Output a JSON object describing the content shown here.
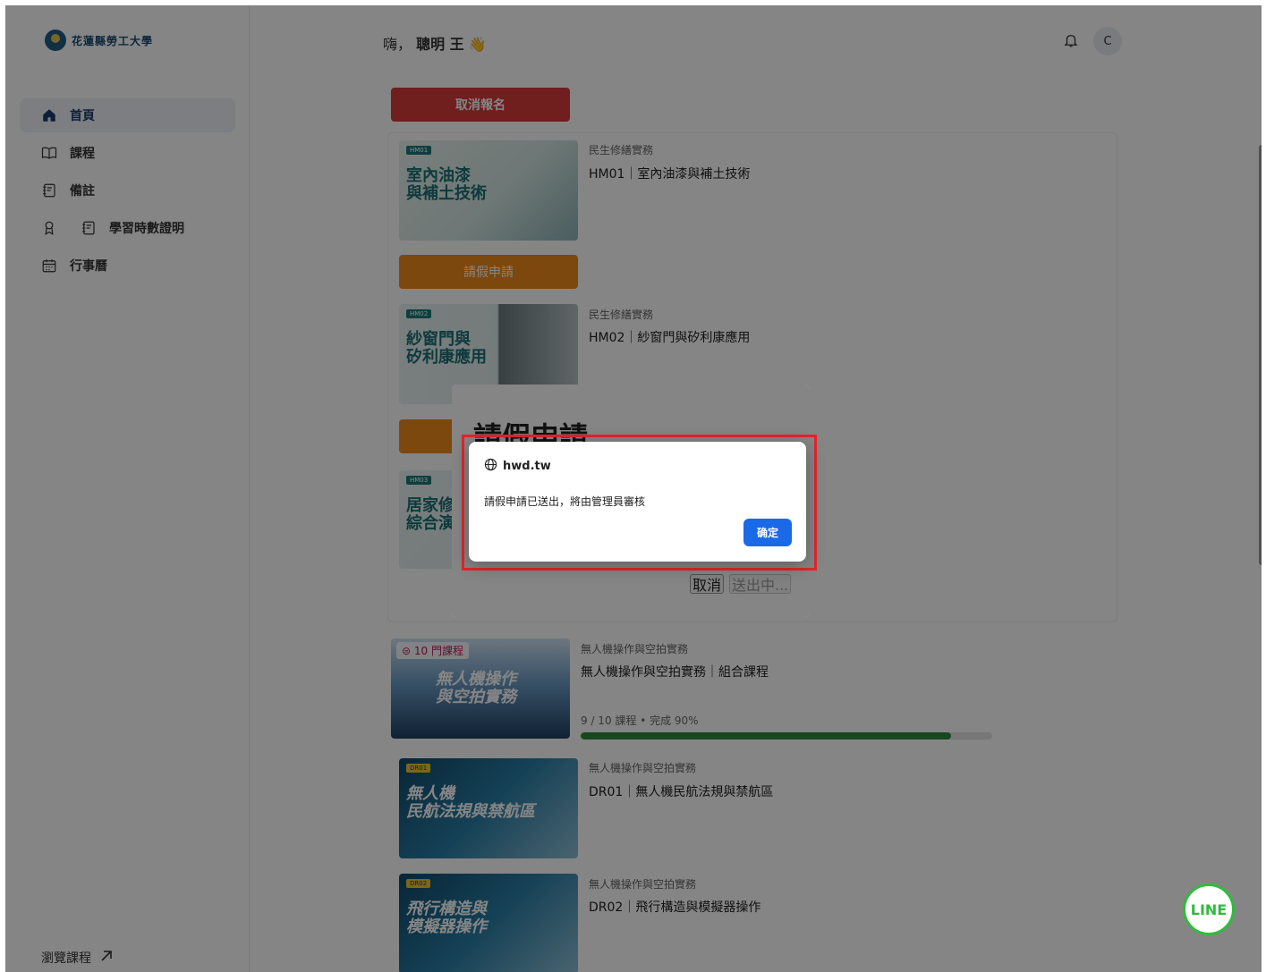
{
  "brand": {
    "title": "花蓮縣勞工大學"
  },
  "header": {
    "greeting_prefix": "嗨，",
    "user_name": "聰明 王",
    "avatar_initial": "C"
  },
  "sidebar": {
    "items": [
      {
        "label": "首頁",
        "icon": "home-icon"
      },
      {
        "label": "課程",
        "icon": "book-icon"
      },
      {
        "label": "備註",
        "icon": "note-icon"
      },
      {
        "label": "學習時數證明",
        "icon": "award-icon"
      },
      {
        "label": "行事曆",
        "icon": "calendar-icon"
      }
    ],
    "browse_label": "瀏覽課程"
  },
  "main": {
    "cancel_registration": "取消報名",
    "leave_button": "請假申請",
    "courses": [
      {
        "category": "民生修繕實務",
        "title": "HM01｜室內油漆與補土技術",
        "thumb_text": "室內油漆\n與補土技術",
        "code": "HM01"
      },
      {
        "category": "民生修繕實務",
        "title": "HM02｜紗窗門與矽利康應用",
        "thumb_text": "紗窗門與\n矽利康應用",
        "code": "HM02"
      },
      {
        "category": "",
        "title": "",
        "thumb_text": "居家修\n綜合演練",
        "code": "HM03"
      }
    ],
    "bundle": {
      "badge": "10 門課程",
      "category": "無人機操作與空拍實務",
      "title": "無人機操作與空拍實務｜組合課程",
      "thumb_text": "無人機操作\n與空拍實務",
      "progress_text": "9 / 10 課程 • 完成 90%",
      "progress": 0.9
    },
    "drone_courses": [
      {
        "category": "無人機操作與空拍實務",
        "title": "DR01｜無人機民航法規與禁航區",
        "thumb_text": "無人機\n民航法規與禁航區",
        "code": "DR01"
      },
      {
        "category": "無人機操作與空拍實務",
        "title": "DR02｜飛行構造與模擬器操作",
        "thumb_text": "飛行構造與\n模擬器操作",
        "code": "DR02"
      }
    ]
  },
  "leave_dialog": {
    "title": "請假申請",
    "cancel": "取消",
    "submitting": "送出中..."
  },
  "alert": {
    "origin": "hwd.tw",
    "message": "請假申請已送出，將由管理員審核",
    "ok": "确定"
  },
  "line_fab": {
    "label": "LINE"
  },
  "colors": {
    "danger": "#d63a3a",
    "warning": "#f08a1c",
    "primary": "#1a6ae8",
    "progress": "#2f8a3a",
    "line": "#2dbd3a",
    "highlight": "#e0262b"
  }
}
